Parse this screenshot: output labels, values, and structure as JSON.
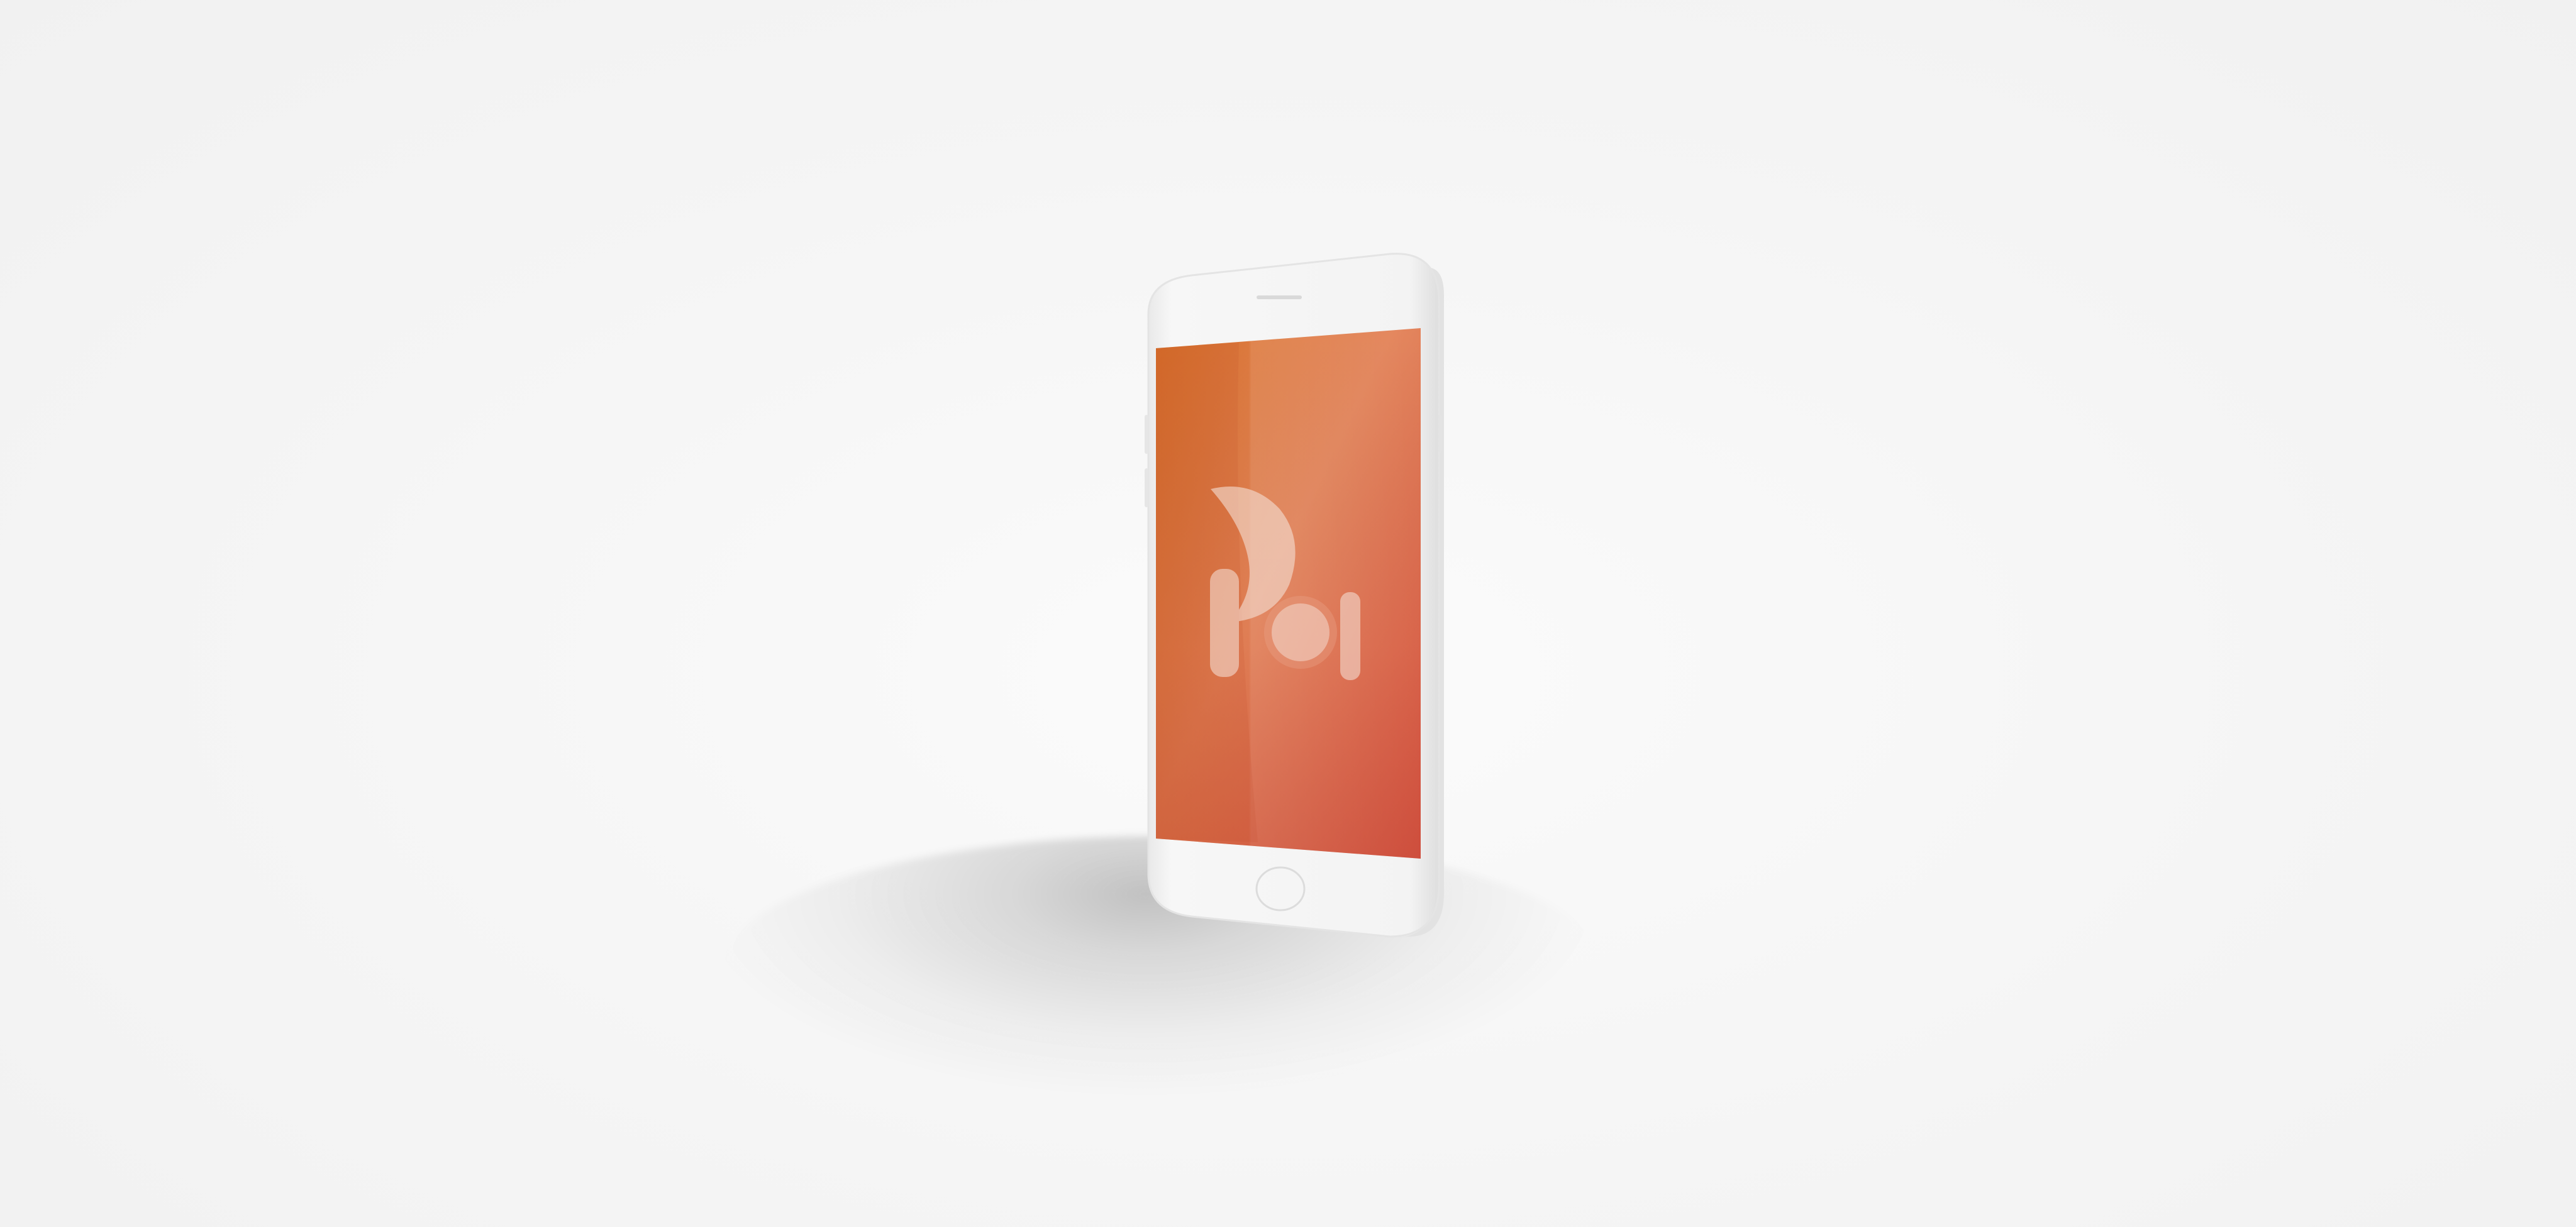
{
  "scene": {
    "description_kind": "product-mockup",
    "background_color": "#f5f5f5"
  },
  "device": {
    "body_color": "#f1f1f1",
    "bezel_color": "#ececec",
    "screen_gradient": [
      "#d9742c",
      "#e48d5c",
      "#d2503a",
      "#db6151"
    ]
  },
  "app_logo": {
    "icon_name": "poi-logo-icon",
    "fill_color": "rgba(255,255,255,0.55)"
  }
}
